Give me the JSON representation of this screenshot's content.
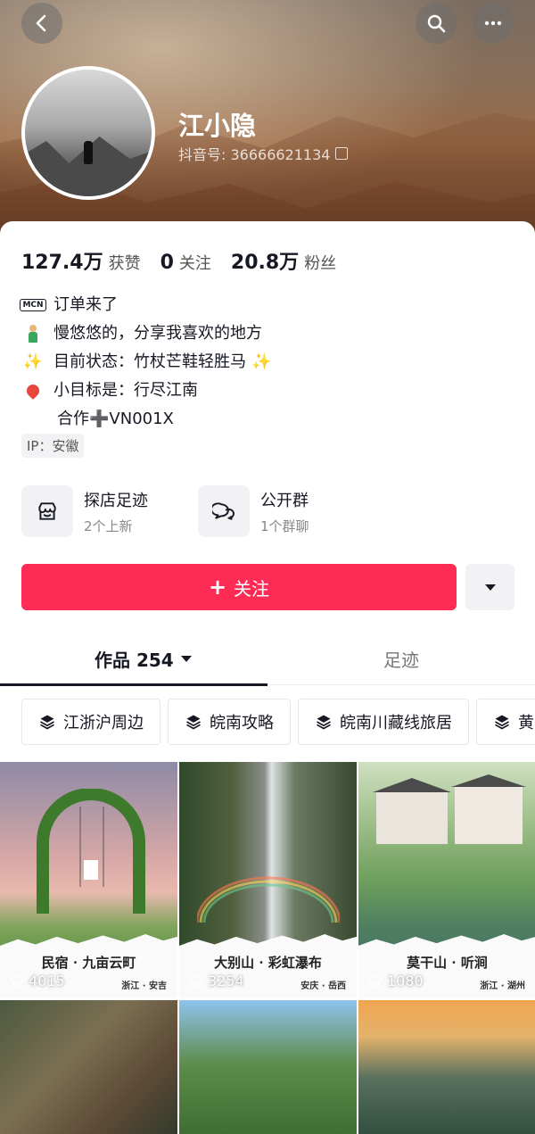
{
  "header": {
    "name": "江小隐",
    "douyin_id": "抖音号: 36666621134"
  },
  "stats": [
    {
      "num": "127.4万",
      "label": "获赞"
    },
    {
      "num": "0",
      "label": "关注"
    },
    {
      "num": "20.8万",
      "label": "粉丝"
    }
  ],
  "bio": {
    "mcn_badge": "MCN",
    "line1": "订单来了",
    "line2": "慢悠悠的，分享我喜欢的地方",
    "line3": "目前状态：竹杖芒鞋轻胜马",
    "line4": "小目标是：行尽江南",
    "line5": "合作➕VN001X"
  },
  "ip": "IP：安徽",
  "features": [
    {
      "title": "探店足迹",
      "subtitle": "2个上新",
      "icon": "store-icon"
    },
    {
      "title": "公开群",
      "subtitle": "1个群聊",
      "icon": "chat-icon"
    }
  ],
  "follow_label": "关注",
  "tabs": {
    "works": "作品 254",
    "footprints": "足迹"
  },
  "chips": [
    "江浙沪周边",
    "皖南攻略",
    "皖南川藏线旅居",
    "黄"
  ],
  "posts": [
    {
      "title": "民宿 · 九亩云町",
      "location": "浙江 · 安吉",
      "likes": "4015"
    },
    {
      "title": "大别山 · 彩虹瀑布",
      "location": "安庆 · 岳西",
      "likes": "3254"
    },
    {
      "title": "莫干山 · 听涧",
      "location": "浙江 · 湖州",
      "likes": "1080"
    },
    {
      "title": "",
      "location": "",
      "likes": ""
    },
    {
      "title": "",
      "location": "",
      "likes": ""
    },
    {
      "title": "",
      "location": "",
      "likes": ""
    }
  ],
  "colors": {
    "accent": "#fe2c55",
    "text": "#161823",
    "chip_border": "#e7e7ea"
  }
}
